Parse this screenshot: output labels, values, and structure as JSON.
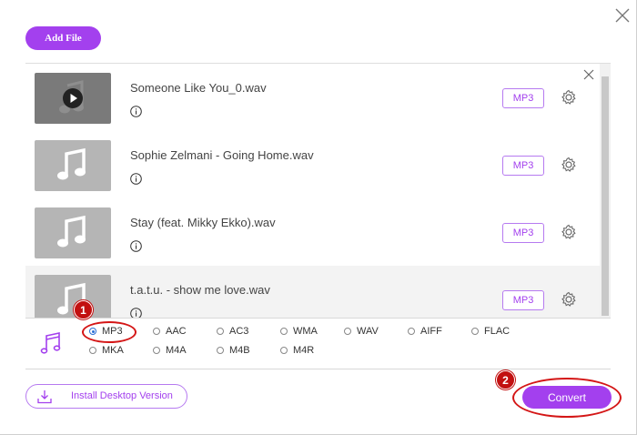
{
  "toolbar": {
    "add_file_label": "Add File"
  },
  "files": [
    {
      "name": "Someone Like You_0.wav",
      "format": "MP3",
      "has_video_preview": true
    },
    {
      "name": "Sophie Zelmani - Going Home.wav",
      "format": "MP3",
      "has_video_preview": false
    },
    {
      "name": "Stay (feat. Mikky Ekko).wav",
      "format": "MP3",
      "has_video_preview": false
    },
    {
      "name": "t.a.t.u. - show me love.wav",
      "format": "MP3",
      "has_video_preview": false
    }
  ],
  "formats": {
    "selected": "MP3",
    "options": [
      "MP3",
      "AAC",
      "AC3",
      "WMA",
      "WAV",
      "AIFF",
      "FLAC",
      "MKA",
      "M4A",
      "M4B",
      "M4R"
    ]
  },
  "footer": {
    "install_label": "Install Desktop Version",
    "convert_label": "Convert"
  },
  "annotations": {
    "step1": "1",
    "step2": "2"
  },
  "icons": {
    "close": "close-icon",
    "info": "info-icon",
    "settings": "gear-icon",
    "audio": "music-note-icon",
    "download": "download-icon",
    "play": "play-icon"
  },
  "colors": {
    "accent": "#a340ee",
    "annotation": "#d41616"
  }
}
